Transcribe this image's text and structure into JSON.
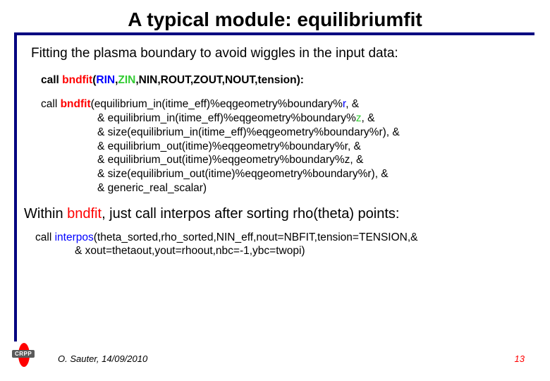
{
  "title": "A typical module: equilibriumfit",
  "intro": "Fitting the plasma boundary to avoid wiggles in the input data:",
  "code1": {
    "pre": "call ",
    "fn": "bndfit",
    "lp": "(",
    "a1": "RIN",
    "c": ",",
    "a2": "ZIN",
    "rest": ",NIN,ROUT,ZOUT,NOUT,tension):"
  },
  "code2": {
    "l1a": "call ",
    "l1fn": "bndfit",
    "l1b": "(equilibrium_in(itime_eff)%eqgeometry%boundary%",
    "l1r": "r",
    "l1c": ", &",
    "l2a": "& equilibrium_in(itime_eff)%eqgeometry%boundary%",
    "l2z": "z",
    "l2c": ", &",
    "l3": "& size(equilibrium_in(itime_eff)%eqgeometry%boundary%r), &",
    "l4": "& equilibrium_out(itime)%eqgeometry%boundary%r, &",
    "l5": "& equilibrium_out(itime)%eqgeometry%boundary%z, &",
    "l6": "& size(equilibrium_out(itime)%eqgeometry%boundary%r), &",
    "l7": "& generic_real_scalar)"
  },
  "within": {
    "a": "Within ",
    "b": "bndfit",
    "c": ", just call interpos after sorting rho(theta) points:"
  },
  "code3": {
    "l1a": "call ",
    "l1fn": "interpos",
    "l1b": "(theta_sorted,rho_sorted,NIN_eff,nout=NBFIT,tension=TENSION,&",
    "l2": "& xout=thetaout,yout=rhoout,nbc=-1,ybc=twopi)"
  },
  "logo_label": "CRPP",
  "footer_author": "O. Sauter, 14/09/2010",
  "footer_page": "13"
}
